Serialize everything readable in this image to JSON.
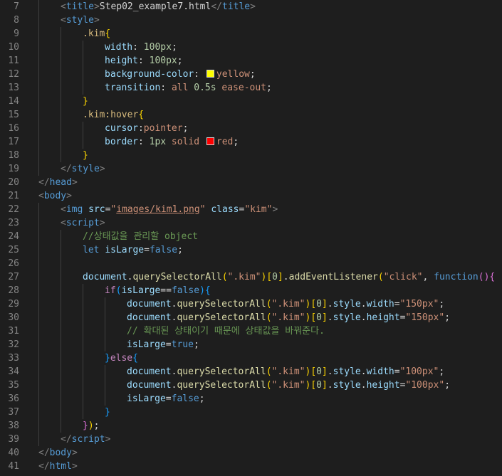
{
  "editor": {
    "language": "html",
    "lines": [
      {
        "n": "7",
        "indent": 1,
        "tokens": [
          {
            "c": "br",
            "t": "<"
          },
          {
            "c": "tag",
            "t": "title"
          },
          {
            "c": "br",
            "t": ">"
          },
          {
            "c": "txt",
            "t": "Step02_example7.html"
          },
          {
            "c": "br",
            "t": "</"
          },
          {
            "c": "tag",
            "t": "title"
          },
          {
            "c": "br",
            "t": ">"
          }
        ]
      },
      {
        "n": "8",
        "indent": 1,
        "tokens": [
          {
            "c": "br",
            "t": "<"
          },
          {
            "c": "tag",
            "t": "style"
          },
          {
            "c": "br",
            "t": ">"
          }
        ]
      },
      {
        "n": "9",
        "indent": 2,
        "tokens": [
          {
            "c": "sel",
            "t": ".kim"
          },
          {
            "c": "b1",
            "t": "{"
          }
        ]
      },
      {
        "n": "10",
        "indent": 3,
        "tokens": [
          {
            "c": "prop",
            "t": "width"
          },
          {
            "c": "txt",
            "t": ": "
          },
          {
            "c": "num",
            "t": "100px"
          },
          {
            "c": "txt",
            "t": ";"
          }
        ]
      },
      {
        "n": "11",
        "indent": 3,
        "tokens": [
          {
            "c": "prop",
            "t": "height"
          },
          {
            "c": "txt",
            "t": ": "
          },
          {
            "c": "num",
            "t": "100px"
          },
          {
            "c": "txt",
            "t": ";"
          }
        ]
      },
      {
        "n": "12",
        "indent": 3,
        "tokens": [
          {
            "c": "prop",
            "t": "background-color"
          },
          {
            "c": "txt",
            "t": ": "
          },
          {
            "swatch": "#ffff00"
          },
          {
            "c": "val",
            "t": "yellow"
          },
          {
            "c": "txt",
            "t": ";"
          }
        ]
      },
      {
        "n": "13",
        "indent": 3,
        "tokens": [
          {
            "c": "prop",
            "t": "transition"
          },
          {
            "c": "txt",
            "t": ": "
          },
          {
            "c": "val",
            "t": "all "
          },
          {
            "c": "num",
            "t": "0.5s"
          },
          {
            "c": "val",
            "t": " ease-out"
          },
          {
            "c": "txt",
            "t": ";"
          }
        ]
      },
      {
        "n": "14",
        "indent": 2,
        "tokens": [
          {
            "c": "b1",
            "t": "}"
          }
        ]
      },
      {
        "n": "15",
        "indent": 2,
        "tokens": [
          {
            "c": "sel",
            "t": ".kim:hover"
          },
          {
            "c": "b1",
            "t": "{"
          }
        ]
      },
      {
        "n": "16",
        "indent": 3,
        "tokens": [
          {
            "c": "prop",
            "t": "cursor"
          },
          {
            "c": "txt",
            "t": ":"
          },
          {
            "c": "val",
            "t": "pointer"
          },
          {
            "c": "txt",
            "t": ";"
          }
        ]
      },
      {
        "n": "17",
        "indent": 3,
        "tokens": [
          {
            "c": "prop",
            "t": "border"
          },
          {
            "c": "txt",
            "t": ": "
          },
          {
            "c": "num",
            "t": "1px"
          },
          {
            "c": "val",
            "t": " solid "
          },
          {
            "swatch": "#ff0000"
          },
          {
            "c": "val",
            "t": "red"
          },
          {
            "c": "txt",
            "t": ";"
          }
        ]
      },
      {
        "n": "18",
        "indent": 2,
        "tokens": [
          {
            "c": "b1",
            "t": "}"
          }
        ]
      },
      {
        "n": "19",
        "indent": 1,
        "tokens": [
          {
            "c": "br",
            "t": "</"
          },
          {
            "c": "tag",
            "t": "style"
          },
          {
            "c": "br",
            "t": ">"
          }
        ]
      },
      {
        "n": "20",
        "indent": 0,
        "tokens": [
          {
            "c": "br",
            "t": "</"
          },
          {
            "c": "tag",
            "t": "head"
          },
          {
            "c": "br",
            "t": ">"
          }
        ]
      },
      {
        "n": "21",
        "indent": 0,
        "tokens": [
          {
            "c": "br",
            "t": "<"
          },
          {
            "c": "tag",
            "t": "body"
          },
          {
            "c": "br",
            "t": ">"
          }
        ]
      },
      {
        "n": "22",
        "indent": 1,
        "tokens": [
          {
            "c": "br",
            "t": "<"
          },
          {
            "c": "tag",
            "t": "img"
          },
          {
            "c": "txt",
            "t": " "
          },
          {
            "c": "attr",
            "t": "src"
          },
          {
            "c": "txt",
            "t": "="
          },
          {
            "c": "str",
            "t": "\""
          },
          {
            "c": "str link",
            "t": "images/kim1.png"
          },
          {
            "c": "str",
            "t": "\""
          },
          {
            "c": "txt",
            "t": " "
          },
          {
            "c": "attr",
            "t": "class"
          },
          {
            "c": "txt",
            "t": "="
          },
          {
            "c": "str",
            "t": "\"kim\""
          },
          {
            "c": "br",
            "t": ">"
          }
        ]
      },
      {
        "n": "23",
        "indent": 1,
        "tokens": [
          {
            "c": "br",
            "t": "<"
          },
          {
            "c": "tag",
            "t": "script"
          },
          {
            "c": "br",
            "t": ">"
          }
        ]
      },
      {
        "n": "24",
        "indent": 2,
        "tokens": [
          {
            "c": "cmt",
            "t": "//상태값을 관리할 object"
          }
        ]
      },
      {
        "n": "25",
        "indent": 2,
        "tokens": [
          {
            "c": "kw",
            "t": "let"
          },
          {
            "c": "txt",
            "t": " "
          },
          {
            "c": "var",
            "t": "isLarge"
          },
          {
            "c": "txt",
            "t": "="
          },
          {
            "c": "kw",
            "t": "false"
          },
          {
            "c": "txt",
            "t": ";"
          }
        ]
      },
      {
        "n": "26",
        "indent": 0,
        "tokens": []
      },
      {
        "n": "27",
        "indent": 2,
        "tokens": [
          {
            "c": "var",
            "t": "document"
          },
          {
            "c": "txt",
            "t": "."
          },
          {
            "c": "fn",
            "t": "querySelectorAll"
          },
          {
            "c": "b1",
            "t": "("
          },
          {
            "c": "str",
            "t": "\".kim\""
          },
          {
            "c": "b1",
            "t": ")"
          },
          {
            "c": "b1",
            "t": "["
          },
          {
            "c": "num",
            "t": "0"
          },
          {
            "c": "b1",
            "t": "]"
          },
          {
            "c": "txt",
            "t": "."
          },
          {
            "c": "fn",
            "t": "addEventListener"
          },
          {
            "c": "b1",
            "t": "("
          },
          {
            "c": "str",
            "t": "\"click\""
          },
          {
            "c": "txt",
            "t": ", "
          },
          {
            "c": "kw",
            "t": "function"
          },
          {
            "c": "b2",
            "t": "()"
          },
          {
            "c": "b2",
            "t": "{"
          }
        ]
      },
      {
        "n": "28",
        "indent": 3,
        "tokens": [
          {
            "c": "ctl",
            "t": "if"
          },
          {
            "c": "b3",
            "t": "("
          },
          {
            "c": "var",
            "t": "isLarge"
          },
          {
            "c": "txt",
            "t": "=="
          },
          {
            "c": "kw",
            "t": "false"
          },
          {
            "c": "b3",
            "t": ")"
          },
          {
            "c": "b3",
            "t": "{"
          }
        ]
      },
      {
        "n": "29",
        "indent": 4,
        "tokens": [
          {
            "c": "var",
            "t": "document"
          },
          {
            "c": "txt",
            "t": "."
          },
          {
            "c": "fn",
            "t": "querySelectorAll"
          },
          {
            "c": "b1",
            "t": "("
          },
          {
            "c": "str",
            "t": "\".kim\""
          },
          {
            "c": "b1",
            "t": ")"
          },
          {
            "c": "b1",
            "t": "["
          },
          {
            "c": "num",
            "t": "0"
          },
          {
            "c": "b1",
            "t": "]"
          },
          {
            "c": "txt",
            "t": "."
          },
          {
            "c": "var",
            "t": "style"
          },
          {
            "c": "txt",
            "t": "."
          },
          {
            "c": "var",
            "t": "width"
          },
          {
            "c": "txt",
            "t": "="
          },
          {
            "c": "str",
            "t": "\"150px\""
          },
          {
            "c": "txt",
            "t": ";"
          }
        ]
      },
      {
        "n": "30",
        "indent": 4,
        "tokens": [
          {
            "c": "var",
            "t": "document"
          },
          {
            "c": "txt",
            "t": "."
          },
          {
            "c": "fn",
            "t": "querySelectorAll"
          },
          {
            "c": "b1",
            "t": "("
          },
          {
            "c": "str",
            "t": "\".kim\""
          },
          {
            "c": "b1",
            "t": ")"
          },
          {
            "c": "b1",
            "t": "["
          },
          {
            "c": "num",
            "t": "0"
          },
          {
            "c": "b1",
            "t": "]"
          },
          {
            "c": "txt",
            "t": "."
          },
          {
            "c": "var",
            "t": "style"
          },
          {
            "c": "txt",
            "t": "."
          },
          {
            "c": "var",
            "t": "height"
          },
          {
            "c": "txt",
            "t": "="
          },
          {
            "c": "str",
            "t": "\"150px\""
          },
          {
            "c": "txt",
            "t": ";"
          }
        ]
      },
      {
        "n": "31",
        "indent": 4,
        "tokens": [
          {
            "c": "cmt",
            "t": "// 확대된 상태이기 때문에 상태값을 바꿔준다."
          }
        ]
      },
      {
        "n": "32",
        "indent": 4,
        "tokens": [
          {
            "c": "var",
            "t": "isLarge"
          },
          {
            "c": "txt",
            "t": "="
          },
          {
            "c": "kw",
            "t": "true"
          },
          {
            "c": "txt",
            "t": ";"
          }
        ]
      },
      {
        "n": "33",
        "indent": 3,
        "tokens": [
          {
            "c": "b3",
            "t": "}"
          },
          {
            "c": "ctl",
            "t": "else"
          },
          {
            "c": "b3",
            "t": "{"
          }
        ]
      },
      {
        "n": "34",
        "indent": 4,
        "tokens": [
          {
            "c": "var",
            "t": "document"
          },
          {
            "c": "txt",
            "t": "."
          },
          {
            "c": "fn",
            "t": "querySelectorAll"
          },
          {
            "c": "b1",
            "t": "("
          },
          {
            "c": "str",
            "t": "\".kim\""
          },
          {
            "c": "b1",
            "t": ")"
          },
          {
            "c": "b1",
            "t": "["
          },
          {
            "c": "num",
            "t": "0"
          },
          {
            "c": "b1",
            "t": "]"
          },
          {
            "c": "txt",
            "t": "."
          },
          {
            "c": "var",
            "t": "style"
          },
          {
            "c": "txt",
            "t": "."
          },
          {
            "c": "var",
            "t": "width"
          },
          {
            "c": "txt",
            "t": "="
          },
          {
            "c": "str",
            "t": "\"100px\""
          },
          {
            "c": "txt",
            "t": ";"
          }
        ]
      },
      {
        "n": "35",
        "indent": 4,
        "tokens": [
          {
            "c": "var",
            "t": "document"
          },
          {
            "c": "txt",
            "t": "."
          },
          {
            "c": "fn",
            "t": "querySelectorAll"
          },
          {
            "c": "b1",
            "t": "("
          },
          {
            "c": "str",
            "t": "\".kim\""
          },
          {
            "c": "b1",
            "t": ")"
          },
          {
            "c": "b1",
            "t": "["
          },
          {
            "c": "num",
            "t": "0"
          },
          {
            "c": "b1",
            "t": "]"
          },
          {
            "c": "txt",
            "t": "."
          },
          {
            "c": "var",
            "t": "style"
          },
          {
            "c": "txt",
            "t": "."
          },
          {
            "c": "var",
            "t": "height"
          },
          {
            "c": "txt",
            "t": "="
          },
          {
            "c": "str",
            "t": "\"100px\""
          },
          {
            "c": "txt",
            "t": ";"
          }
        ]
      },
      {
        "n": "36",
        "indent": 4,
        "tokens": [
          {
            "c": "var",
            "t": "isLarge"
          },
          {
            "c": "txt",
            "t": "="
          },
          {
            "c": "kw",
            "t": "false"
          },
          {
            "c": "txt",
            "t": ";"
          }
        ]
      },
      {
        "n": "37",
        "indent": 3,
        "tokens": [
          {
            "c": "b3",
            "t": "}"
          }
        ]
      },
      {
        "n": "38",
        "indent": 2,
        "tokens": [
          {
            "c": "b2",
            "t": "}"
          },
          {
            "c": "b1",
            "t": ")"
          },
          {
            "c": "txt",
            "t": ";"
          }
        ]
      },
      {
        "n": "39",
        "indent": 1,
        "tokens": [
          {
            "c": "br",
            "t": "</"
          },
          {
            "c": "tag",
            "t": "script"
          },
          {
            "c": "br",
            "t": ">"
          }
        ]
      },
      {
        "n": "40",
        "indent": 0,
        "tokens": [
          {
            "c": "br",
            "t": "</"
          },
          {
            "c": "tag",
            "t": "body"
          },
          {
            "c": "br",
            "t": ">"
          }
        ]
      },
      {
        "n": "41",
        "indent": 0,
        "tokens": [
          {
            "c": "br",
            "t": "</"
          },
          {
            "c": "tag",
            "t": "html"
          },
          {
            "c": "br",
            "t": ">"
          }
        ]
      }
    ]
  }
}
